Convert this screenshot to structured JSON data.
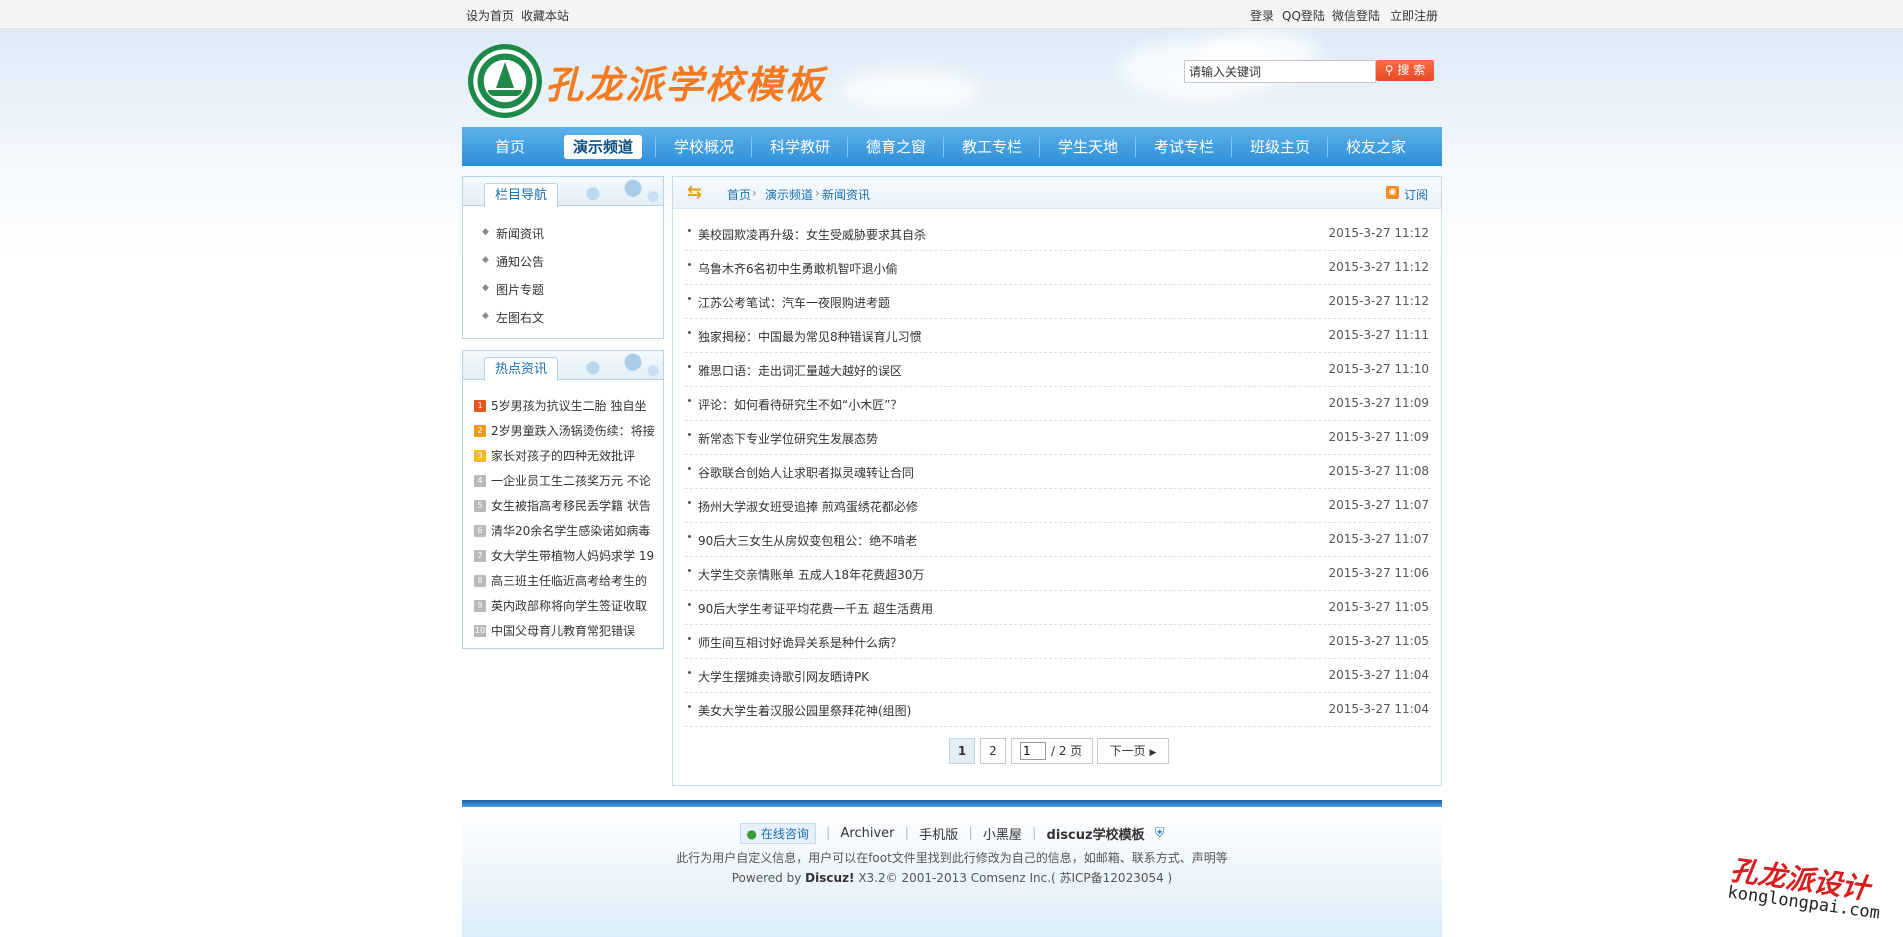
{
  "topbar": {
    "set_home": "设为首页",
    "bookmark": "收藏本站",
    "login": "登录",
    "qq_login": "QQ登陆",
    "wechat_login": "微信登陆",
    "register": "立即注册"
  },
  "header": {
    "site_title": "孔龙派学校模板",
    "search_value": "请输入关键词",
    "search_button": "搜 索"
  },
  "nav": {
    "items": [
      {
        "label": "首页"
      },
      {
        "label": "演示频道",
        "active": true
      },
      {
        "label": "学校概况"
      },
      {
        "label": "科学教研"
      },
      {
        "label": "德育之窗"
      },
      {
        "label": "教工专栏"
      },
      {
        "label": "学生天地"
      },
      {
        "label": "考试专栏"
      },
      {
        "label": "班级主页"
      },
      {
        "label": "校友之家"
      }
    ]
  },
  "sidebar": {
    "category_title": "栏目导航",
    "categories": [
      "新闻资讯",
      "通知公告",
      "图片专题",
      "左图右文"
    ],
    "hot_title": "热点资讯",
    "hot": [
      {
        "num": "1",
        "title": "5岁男孩为抗议生二胎 独自坐"
      },
      {
        "num": "2",
        "title": "2岁男童跌入汤锅烫伤续：将接"
      },
      {
        "num": "3",
        "title": "家长对孩子的四种无效批评"
      },
      {
        "num": "4",
        "title": "一企业员工生二孩奖万元 不论"
      },
      {
        "num": "5",
        "title": "女生被指高考移民丢学籍 状告"
      },
      {
        "num": "6",
        "title": "清华20余名学生感染诺如病毒"
      },
      {
        "num": "7",
        "title": "女大学生带植物人妈妈求学 19"
      },
      {
        "num": "8",
        "title": "高三班主任临近高考给考生的"
      },
      {
        "num": "9",
        "title": "英内政部称将向学生签证收取"
      },
      {
        "num": "10",
        "title": "中国父母育儿教育常犯错误"
      }
    ],
    "hot_colors": {
      "top": "#e8541e",
      "second": "#f29a1e",
      "third": "#f6b81f",
      "rest": "#b9b9b9"
    }
  },
  "breadcrumb": {
    "home": "首页",
    "sep": "›",
    "channel": "演示频道",
    "current": "新闻资讯",
    "rss_label": "订阅"
  },
  "news": [
    {
      "title": "美校园欺凌再升级：女生受威胁要求其自杀",
      "date": "2015-3-27 11:12"
    },
    {
      "title": "乌鲁木齐6名初中生勇敢机智吓退小偷",
      "date": "2015-3-27 11:12"
    },
    {
      "title": "江苏公考笔试：汽车一夜限购进考题",
      "date": "2015-3-27 11:12"
    },
    {
      "title": "独家揭秘：中国最为常见8种错误育儿习惯",
      "date": "2015-3-27 11:11"
    },
    {
      "title": "雅思口语：走出词汇量越大越好的误区",
      "date": "2015-3-27 11:10"
    },
    {
      "title": "评论：如何看待研究生不如“小木匠”？",
      "date": "2015-3-27 11:09"
    },
    {
      "title": "新常态下专业学位研究生发展态势",
      "date": "2015-3-27 11:09"
    },
    {
      "title": "谷歌联合创始人让求职者拟灵魂转让合同",
      "date": "2015-3-27 11:08"
    },
    {
      "title": "扬州大学淑女班受追捧 煎鸡蛋绣花都必修",
      "date": "2015-3-27 11:07"
    },
    {
      "title": "90后大三女生从房奴变包租公：绝不啃老",
      "date": "2015-3-27 11:07"
    },
    {
      "title": "大学生交亲情账单 五成人18年花费超30万",
      "date": "2015-3-27 11:06"
    },
    {
      "title": "90后大学生考证平均花费一千五 超生活费用",
      "date": "2015-3-27 11:05"
    },
    {
      "title": "师生间互相讨好诡异关系是种什么病？",
      "date": "2015-3-27 11:05"
    },
    {
      "title": "大学生摆摊卖诗歌引网友晒诗PK",
      "date": "2015-3-27 11:04"
    },
    {
      "title": "美女大学生着汉服公园里祭拜花神(组图)",
      "date": "2015-3-27 11:04"
    }
  ],
  "pager": {
    "page1": "1",
    "page2": "2",
    "input_value": "1",
    "total": "/ 2 页",
    "next": "下一页"
  },
  "footer": {
    "online": "在线咨询",
    "links": [
      "Archiver",
      "手机版",
      "小黑屋"
    ],
    "brand": "discuz学校模板",
    "info": "此行为用户自定义信息，用户可以在foot文件里找到此行修改为自己的信息，如邮箱、联系方式、声明等",
    "powered_prefix": "Powered by",
    "powered_name": "Discuz!",
    "powered_version": "X3.2",
    "copyright": "© 2001-2013",
    "company": "Comsenz Inc.",
    "icp": "( 苏ICP备12023054 )"
  },
  "watermark": {
    "cn": "孔龙派设计",
    "url": "konglongpai.com"
  }
}
